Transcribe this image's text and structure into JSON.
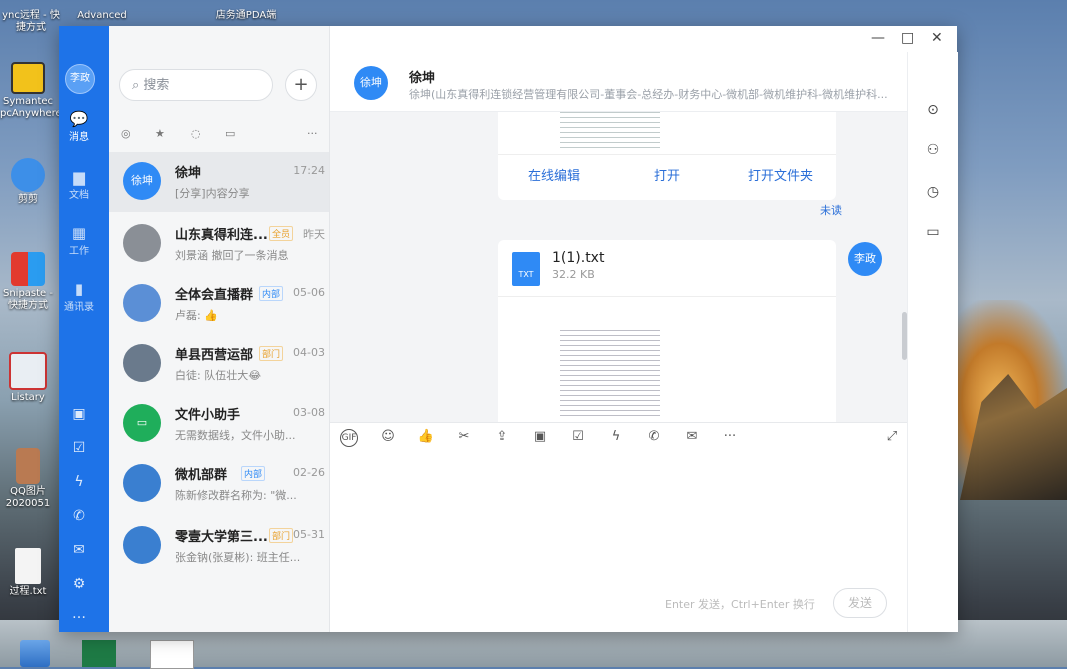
{
  "desktop": {
    "top_labels": [
      "ync远程 - 快捷方式",
      "Advanced",
      "店务通PDA端"
    ],
    "icons": [
      {
        "label": "Symantec pcAnywhere"
      },
      {
        "label": "剪剪"
      },
      {
        "label": "Snipaste - 快捷方式"
      },
      {
        "label": "Listary"
      },
      {
        "label": "QQ图片2020051"
      },
      {
        "label": "过程.txt"
      }
    ]
  },
  "window": {
    "controls": {
      "minimize": "—",
      "maximize": "□",
      "close": "✕"
    }
  },
  "rail": {
    "avatar": "李政",
    "nav": [
      {
        "label": "消息",
        "icon": "message-icon"
      },
      {
        "label": "文档",
        "icon": "document-icon"
      },
      {
        "label": "工作",
        "icon": "work-grid-icon"
      },
      {
        "label": "通讯录",
        "icon": "contacts-icon"
      }
    ],
    "tools": [
      "calendar-icon",
      "todo-icon",
      "ding-icon",
      "phone-icon",
      "mail-icon",
      "settings-icon",
      "more-icon"
    ],
    "more_label": "…"
  },
  "list": {
    "search_placeholder": "搜索",
    "conversations": [
      {
        "avatar": "徐坤",
        "name": "徐坤",
        "time": "17:24",
        "preview": "[分享]内容分享",
        "tag": "",
        "color": "#2f8af5"
      },
      {
        "avatar": "",
        "name": "山东真得利连...",
        "time": "昨天",
        "preview": "刘景涵 撤回了一条消息",
        "tag": "全员",
        "color": "#8a8f96"
      },
      {
        "avatar": "",
        "name": "全体会直播群",
        "time": "05-06",
        "preview": "卢磊: 👍",
        "tag": "内部",
        "color": "#5b8fd6"
      },
      {
        "avatar": "",
        "name": "单县西营运部",
        "time": "04-03",
        "preview": "白徒: 队伍壮大😂",
        "tag": "部门",
        "color": "#6a7a8c"
      },
      {
        "avatar": "",
        "name": "文件小助手",
        "time": "03-08",
        "preview": "无需数据线，文件小助...",
        "tag": "",
        "color": "#1fae5b"
      },
      {
        "avatar": "",
        "name": "微机部群",
        "time": "02-26",
        "preview": "陈新修改群名称为: \"微...",
        "tag": "内部",
        "color": "#3a7fd0"
      },
      {
        "avatar": "",
        "name": "零壹大学第三...",
        "time": "05-31",
        "preview": "张金钠(张夏彬): 班主任...",
        "tag": "部门",
        "color": "#3a7fd0"
      }
    ]
  },
  "chat": {
    "header": {
      "avatar": "徐坤",
      "title": "徐坤",
      "subtitle": "徐坤(山东真得利连锁经营管理有限公司-董事会-总经办-财务中心-微机部-微机维护科-微机维护科..."
    },
    "card1_actions": [
      "在线编辑",
      "打开",
      "打开文件夹"
    ],
    "unread_label": "未读",
    "file": {
      "type_label": "TXT",
      "name": "1(1).txt",
      "size": "32.2 KB"
    },
    "me_avatar": "李政",
    "input_hint": "Enter 发送，Ctrl+Enter 换行",
    "send_label": "发送",
    "toolbar_more": "···"
  }
}
